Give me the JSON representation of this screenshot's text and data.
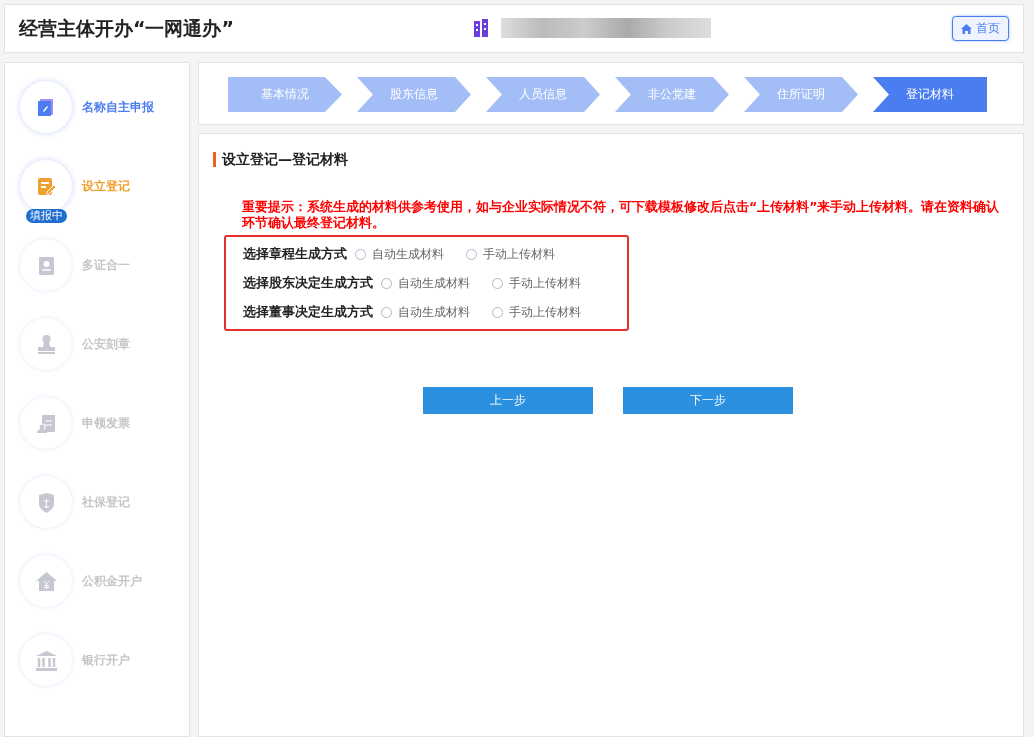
{
  "header": {
    "title": "经营主体开办“一网通办”",
    "home_button": "首页"
  },
  "sidebar": {
    "items": [
      {
        "label": "名称自主申报",
        "kind": "done"
      },
      {
        "label": "设立登记",
        "kind": "current",
        "badge": "填报中"
      },
      {
        "label": "多证合一",
        "kind": "pending"
      },
      {
        "label": "公安刻章",
        "kind": "pending"
      },
      {
        "label": "申领发票",
        "kind": "pending"
      },
      {
        "label": "社保登记",
        "kind": "pending"
      },
      {
        "label": "公积金开户",
        "kind": "pending"
      },
      {
        "label": "银行开户",
        "kind": "pending"
      }
    ]
  },
  "steps": [
    {
      "label": "基本情况",
      "selected": false
    },
    {
      "label": "股东信息",
      "selected": false
    },
    {
      "label": "人员信息",
      "selected": false
    },
    {
      "label": "非公党建",
      "selected": false
    },
    {
      "label": "住所证明",
      "selected": false
    },
    {
      "label": "登记材料",
      "selected": true
    }
  ],
  "section": {
    "title": "设立登记—登记材料",
    "notice": "重要提示：系统生成的材料供参考使用，如与企业实际情况不符，可下载模板修改后点击“上传材料”来手动上传材料。请在资料确认环节确认最终登记材料。",
    "questions": [
      {
        "label": "选择章程生成方式",
        "options": [
          {
            "label": "自动生成材料",
            "selected": false
          },
          {
            "label": "手动上传材料",
            "selected": false
          }
        ]
      },
      {
        "label": "选择股东决定生成方式",
        "options": [
          {
            "label": "自动生成材料",
            "selected": false
          },
          {
            "label": "手动上传材料",
            "selected": false
          }
        ]
      },
      {
        "label": "选择董事决定生成方式",
        "options": [
          {
            "label": "自动生成材料",
            "selected": false
          },
          {
            "label": "手动上传材料",
            "selected": false
          }
        ]
      }
    ],
    "buttons": [
      "上一步",
      "下一步"
    ]
  }
}
